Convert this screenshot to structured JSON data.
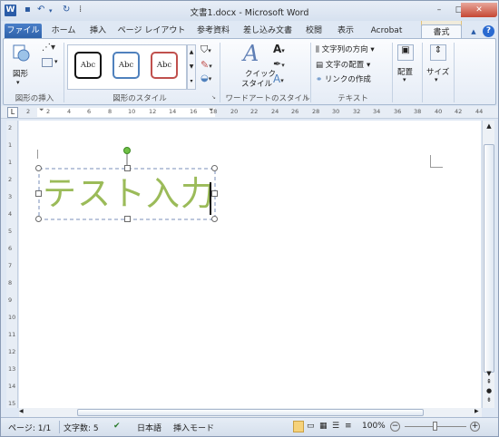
{
  "window": {
    "title": "文書1.docx - Microsoft Word"
  },
  "quick_access": {
    "save_icon": "save-icon",
    "undo_icon": "undo-icon",
    "redo_icon": "redo-icon"
  },
  "window_controls": {
    "minimize": "–",
    "maximize": "□",
    "close": "✕"
  },
  "tabs": [
    "ファイル",
    "ホーム",
    "挿入",
    "ページ レイアウト",
    "参考資料",
    "差し込み文書",
    "校閲",
    "表示",
    "Acrobat",
    "書式"
  ],
  "help": "?",
  "ribbon": {
    "insert_shapes": {
      "shapes_label": "図形",
      "group_label": "図形の挿入"
    },
    "shape_styles": {
      "styles": [
        "Abc",
        "Abc",
        "Abc"
      ],
      "group_label": "図形のスタイル"
    },
    "wordart": {
      "quick_style": "クイック",
      "quick_style2": "スタイル",
      "group_label": "ワードアートのスタイル"
    },
    "text": {
      "direction": "文字列の方向",
      "align": "文字の配置",
      "link": "リンクの作成",
      "group_label": "テキスト"
    },
    "arrange": {
      "label": "配置"
    },
    "size": {
      "label": "サイズ"
    }
  },
  "ruler": {
    "numbers": [
      "2",
      "2",
      "4",
      "6",
      "8",
      "10",
      "12",
      "14",
      "16",
      "18",
      "20",
      "22",
      "24",
      "26",
      "28",
      "30",
      "32",
      "34",
      "36",
      "38",
      "40",
      "42",
      "44"
    ],
    "vnumbers": [
      "2",
      "1",
      "1",
      "2",
      "3",
      "4",
      "5",
      "6",
      "7",
      "8",
      "9",
      "10",
      "11",
      "12",
      "13",
      "14",
      "15"
    ]
  },
  "document": {
    "text": "テスト入力",
    "text_color": "#9bbb59"
  },
  "status_bar": {
    "page": "ページ: 1/1",
    "words": "文字数: 5",
    "lang": "日本語",
    "mode": "挿入モード",
    "zoom": "100%"
  }
}
